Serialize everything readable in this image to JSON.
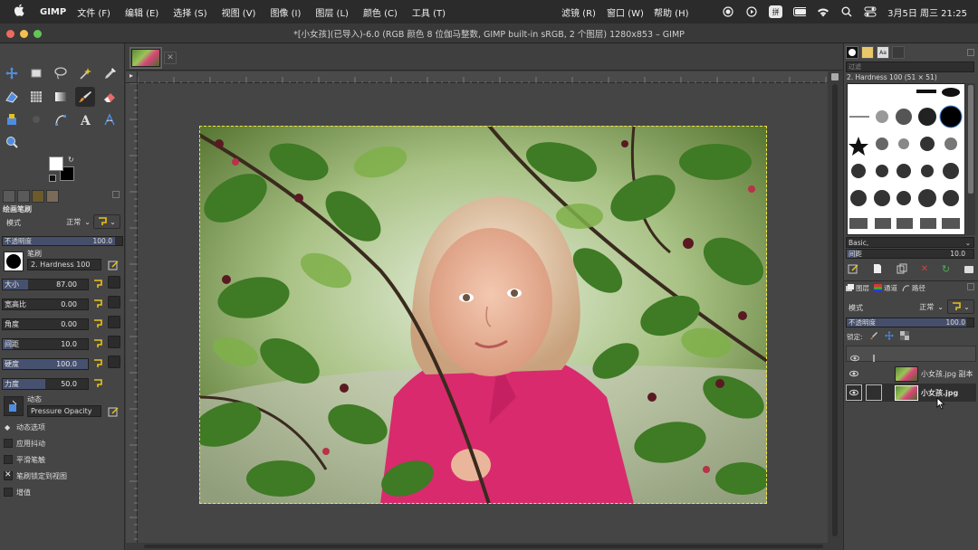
{
  "menubar": {
    "app_name": "GIMP",
    "items": [
      "文件 (F)",
      "编辑 (E)",
      "选择 (S)",
      "视图 (V)",
      "图像 (I)",
      "图层 (L)",
      "颜色 (C)",
      "工具 (T)",
      "滤镜 (R)",
      "窗口 (W)",
      "帮助 (H)"
    ],
    "input_method": "拼",
    "datetime": "3月5日 周三  21:25"
  },
  "window": {
    "title": "*[小女孩](已导入)-6.0 (RGB 颜色 8 位伽马整数, GIMP built-in sRGB, 2 个图层) 1280x853 – GIMP"
  },
  "toolbox": {
    "panel_title": "绘画笔刷",
    "mode_label": "模式",
    "mode_value": "正常",
    "opacity_label": "不透明度",
    "opacity_value": "100.0",
    "brush_label": "笔刷",
    "brush_name": "2. Hardness 100",
    "size_label": "大小",
    "size_value": "87.00",
    "aspect_label": "宽高比",
    "aspect_value": "0.00",
    "angle_label": "角度",
    "angle_value": "0.00",
    "spacing_label": "间距",
    "spacing_value": "10.0",
    "hardness_label": "硬度",
    "hardness_value": "100.0",
    "force_label": "力度",
    "force_value": "50.0",
    "dynamics_label": "动态",
    "dynamics_value": "Pressure Opacity",
    "dynamics_options": "动态选项",
    "apply_jitter": "应用抖动",
    "smooth_stroke": "平滑笔触",
    "lock_brush": "笔刷锁定到视图",
    "incremental": "增值"
  },
  "dock": {
    "brush_filter_placeholder": "过滤",
    "brush_title": "2. Hardness 100 (51 × 51)",
    "brush_preset": "Basic,",
    "spacing_label": "间距",
    "spacing_value": "10.0",
    "tab_layers": "图层",
    "tab_channels": "通道",
    "tab_paths": "路径",
    "mode_label": "模式",
    "mode_value": "正常",
    "opacity_label": "不透明度",
    "opacity_value": "100.0",
    "lock_label": "锁定:",
    "layers": [
      {
        "name": "小女孩.jpg 副本"
      },
      {
        "name": "小女孩.jpg"
      }
    ]
  },
  "colors": {
    "accent": "#5b6fa8",
    "selection": "#f2e34a",
    "icon_yellow": "#e8c21a"
  }
}
